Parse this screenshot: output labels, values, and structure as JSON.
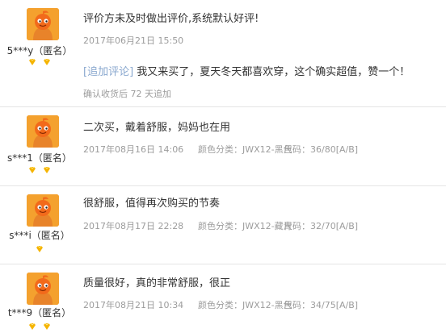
{
  "reviews": [
    {
      "user": "5***y（匿名）",
      "badge_count": 2,
      "text": "评价方未及时做出评价,系统默认好评!",
      "date": "2017年06月21日 15:50",
      "sku_label": "",
      "sku_value": "",
      "size_label": "",
      "size_value": "",
      "append": {
        "label": "[追加评论]",
        "text": "我又来买了，夏天冬天都喜欢穿，这个确实超值，赞一个！",
        "meta": "确认收货后 72 天追加"
      }
    },
    {
      "user": "s***1（匿名）",
      "badge_count": 2,
      "text": "二次买，戴着舒服，妈妈也在用",
      "date": "2017年08月16日 14:06",
      "sku_label": "颜色分类：",
      "sku_value": "JWX12-黑色",
      "size_label": "尺码：",
      "size_value": "36/80[A/B]"
    },
    {
      "user": "s***i（匿名）",
      "badge_count": 1,
      "text": "很舒服，值得再次购买的节奏",
      "date": "2017年08月17日 22:28",
      "sku_label": "颜色分类：",
      "sku_value": "JWX12-藏青",
      "size_label": "尺码：",
      "size_value": "32/70[A/B]"
    },
    {
      "user": "t***9（匿名）",
      "badge_count": 2,
      "text": "质量很好，真的非常舒服，很正",
      "date": "2017年08月21日 10:34",
      "sku_label": "颜色分类：",
      "sku_value": "JWX12-黑色",
      "size_label": "尺码：",
      "size_value": "34/75[A/B]"
    }
  ],
  "colors": {
    "avatar_bg": "#f4a12e",
    "badge": "#f5b400",
    "meta": "#9c9c9c",
    "append_label": "#8aa8cf"
  },
  "icons": {
    "avatar": "orange-mascot-avatar-icon",
    "badge": "gold-diamond-icon"
  }
}
